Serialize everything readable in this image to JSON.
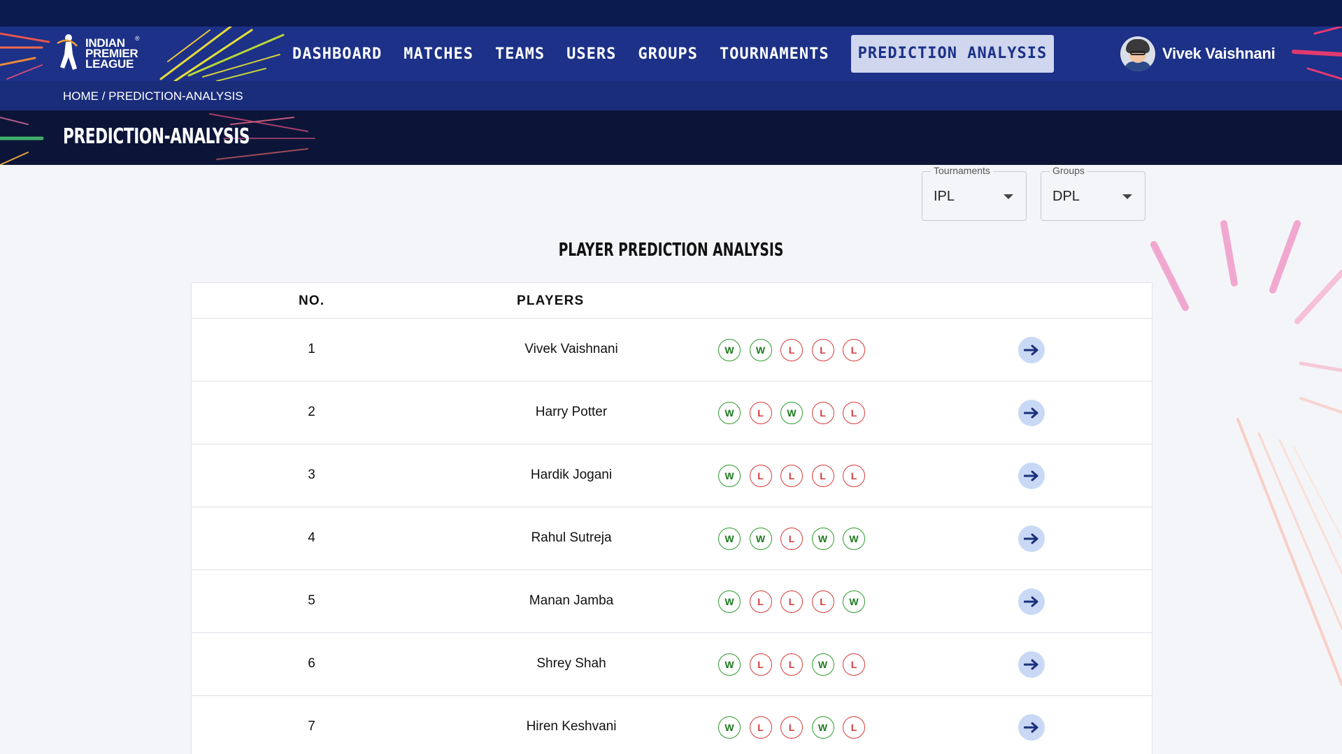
{
  "brand": {
    "logo_line1": "INDIAN",
    "logo_line2": "PREMIER",
    "logo_line3": "LEAGUE",
    "logo_reg": "®"
  },
  "nav": {
    "items": [
      "DASHBOARD",
      "MATCHES",
      "TEAMS",
      "USERS",
      "GROUPS",
      "TOURNAMENTS",
      "PREDICTION ANALYSIS"
    ],
    "active": "PREDICTION ANALYSIS"
  },
  "user": {
    "name": "Vivek Vaishnani"
  },
  "breadcrumb": "HOME / PREDICTION-ANALYSIS",
  "page_title": "PREDICTION-ANALYSIS",
  "filters": {
    "tournaments": {
      "label": "Tournaments",
      "value": "IPL"
    },
    "groups": {
      "label": "Groups",
      "value": "DPL"
    }
  },
  "section_title": "PLAYER PREDICTION ANALYSIS",
  "table": {
    "headers": {
      "no": "NO.",
      "players": "PLAYERS"
    },
    "rows": [
      {
        "no": "1",
        "name": "Vivek Vaishnani",
        "results": [
          "W",
          "W",
          "L",
          "L",
          "L"
        ]
      },
      {
        "no": "2",
        "name": "Harry Potter",
        "results": [
          "W",
          "L",
          "W",
          "L",
          "L"
        ]
      },
      {
        "no": "3",
        "name": "Hardik Jogani",
        "results": [
          "W",
          "L",
          "L",
          "L",
          "L"
        ]
      },
      {
        "no": "4",
        "name": "Rahul Sutreja",
        "results": [
          "W",
          "W",
          "L",
          "W",
          "W"
        ]
      },
      {
        "no": "5",
        "name": "Manan Jamba",
        "results": [
          "W",
          "L",
          "L",
          "L",
          "W"
        ]
      },
      {
        "no": "6",
        "name": "Shrey Shah",
        "results": [
          "W",
          "L",
          "L",
          "W",
          "L"
        ]
      },
      {
        "no": "7",
        "name": "Hiren Keshvani",
        "results": [
          "W",
          "L",
          "L",
          "W",
          "L"
        ]
      }
    ]
  },
  "colors": {
    "nav_bg": "#1c3187",
    "header_dark": "#0c1538",
    "win": "#2e9a2e",
    "loss": "#d63a3a",
    "action_bg": "#c9d9f5"
  },
  "icons": {
    "row_action": "arrow-right-icon"
  }
}
